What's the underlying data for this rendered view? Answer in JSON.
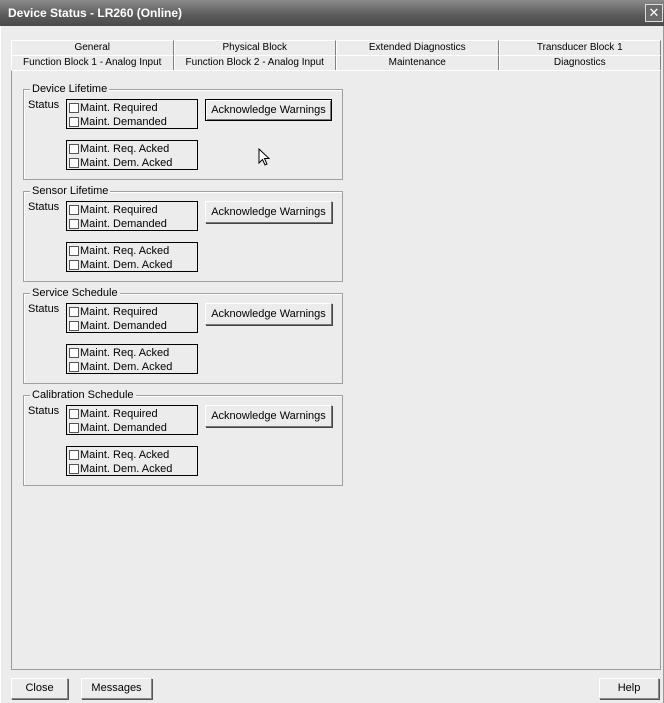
{
  "window": {
    "title": "Device Status - LR260  (Online)",
    "close_glyph": "✕"
  },
  "tabs": {
    "row1": [
      "General",
      "Physical Block",
      "Extended Diagnostics",
      "Transducer Block 1"
    ],
    "row2": [
      "Function Block 1 - Analog Input",
      "Function Block 2 - Analog Input",
      "Maintenance",
      "Diagnostics"
    ],
    "active": "Maintenance"
  },
  "groups": [
    {
      "title": "Device Lifetime",
      "status_label": "Status",
      "checks_top": [
        "Maint. Required",
        "Maint. Demanded"
      ],
      "checks_bottom": [
        "Maint. Req. Acked",
        "Maint. Dem. Acked"
      ],
      "button": "Acknowledge Warnings"
    },
    {
      "title": "Sensor Lifetime",
      "status_label": "Status",
      "checks_top": [
        "Maint. Required",
        "Maint. Demanded"
      ],
      "checks_bottom": [
        "Maint. Req. Acked",
        "Maint. Dem. Acked"
      ],
      "button": "Acknowledge Warnings"
    },
    {
      "title": "Service Schedule",
      "status_label": "Status",
      "checks_top": [
        "Maint. Required",
        "Maint. Demanded"
      ],
      "checks_bottom": [
        "Maint. Req. Acked",
        "Maint. Dem. Acked"
      ],
      "button": "Acknowledge Warnings"
    },
    {
      "title": "Calibration Schedule",
      "status_label": "Status",
      "checks_top": [
        "Maint. Required",
        "Maint. Demanded"
      ],
      "checks_bottom": [
        "Maint. Req. Acked",
        "Maint. Dem. Acked"
      ],
      "button": "Acknowledge Warnings"
    }
  ],
  "footer": {
    "close": "Close",
    "messages": "Messages",
    "help": "Help"
  }
}
